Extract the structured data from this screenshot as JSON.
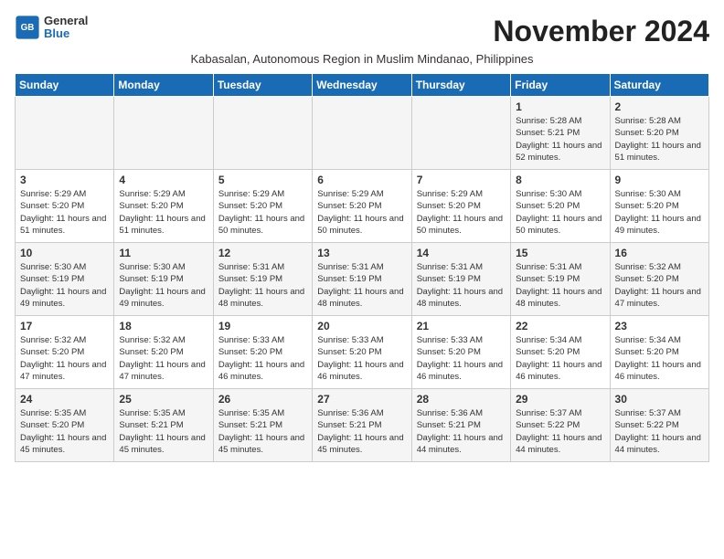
{
  "logo": {
    "general": "General",
    "blue": "Blue"
  },
  "title": "November 2024",
  "subtitle": "Kabasalan, Autonomous Region in Muslim Mindanao, Philippines",
  "headers": [
    "Sunday",
    "Monday",
    "Tuesday",
    "Wednesday",
    "Thursday",
    "Friday",
    "Saturday"
  ],
  "weeks": [
    [
      {
        "day": "",
        "info": ""
      },
      {
        "day": "",
        "info": ""
      },
      {
        "day": "",
        "info": ""
      },
      {
        "day": "",
        "info": ""
      },
      {
        "day": "",
        "info": ""
      },
      {
        "day": "1",
        "info": "Sunrise: 5:28 AM\nSunset: 5:21 PM\nDaylight: 11 hours and 52 minutes."
      },
      {
        "day": "2",
        "info": "Sunrise: 5:28 AM\nSunset: 5:20 PM\nDaylight: 11 hours and 51 minutes."
      }
    ],
    [
      {
        "day": "3",
        "info": "Sunrise: 5:29 AM\nSunset: 5:20 PM\nDaylight: 11 hours and 51 minutes."
      },
      {
        "day": "4",
        "info": "Sunrise: 5:29 AM\nSunset: 5:20 PM\nDaylight: 11 hours and 51 minutes."
      },
      {
        "day": "5",
        "info": "Sunrise: 5:29 AM\nSunset: 5:20 PM\nDaylight: 11 hours and 50 minutes."
      },
      {
        "day": "6",
        "info": "Sunrise: 5:29 AM\nSunset: 5:20 PM\nDaylight: 11 hours and 50 minutes."
      },
      {
        "day": "7",
        "info": "Sunrise: 5:29 AM\nSunset: 5:20 PM\nDaylight: 11 hours and 50 minutes."
      },
      {
        "day": "8",
        "info": "Sunrise: 5:30 AM\nSunset: 5:20 PM\nDaylight: 11 hours and 50 minutes."
      },
      {
        "day": "9",
        "info": "Sunrise: 5:30 AM\nSunset: 5:20 PM\nDaylight: 11 hours and 49 minutes."
      }
    ],
    [
      {
        "day": "10",
        "info": "Sunrise: 5:30 AM\nSunset: 5:19 PM\nDaylight: 11 hours and 49 minutes."
      },
      {
        "day": "11",
        "info": "Sunrise: 5:30 AM\nSunset: 5:19 PM\nDaylight: 11 hours and 49 minutes."
      },
      {
        "day": "12",
        "info": "Sunrise: 5:31 AM\nSunset: 5:19 PM\nDaylight: 11 hours and 48 minutes."
      },
      {
        "day": "13",
        "info": "Sunrise: 5:31 AM\nSunset: 5:19 PM\nDaylight: 11 hours and 48 minutes."
      },
      {
        "day": "14",
        "info": "Sunrise: 5:31 AM\nSunset: 5:19 PM\nDaylight: 11 hours and 48 minutes."
      },
      {
        "day": "15",
        "info": "Sunrise: 5:31 AM\nSunset: 5:19 PM\nDaylight: 11 hours and 48 minutes."
      },
      {
        "day": "16",
        "info": "Sunrise: 5:32 AM\nSunset: 5:20 PM\nDaylight: 11 hours and 47 minutes."
      }
    ],
    [
      {
        "day": "17",
        "info": "Sunrise: 5:32 AM\nSunset: 5:20 PM\nDaylight: 11 hours and 47 minutes."
      },
      {
        "day": "18",
        "info": "Sunrise: 5:32 AM\nSunset: 5:20 PM\nDaylight: 11 hours and 47 minutes."
      },
      {
        "day": "19",
        "info": "Sunrise: 5:33 AM\nSunset: 5:20 PM\nDaylight: 11 hours and 46 minutes."
      },
      {
        "day": "20",
        "info": "Sunrise: 5:33 AM\nSunset: 5:20 PM\nDaylight: 11 hours and 46 minutes."
      },
      {
        "day": "21",
        "info": "Sunrise: 5:33 AM\nSunset: 5:20 PM\nDaylight: 11 hours and 46 minutes."
      },
      {
        "day": "22",
        "info": "Sunrise: 5:34 AM\nSunset: 5:20 PM\nDaylight: 11 hours and 46 minutes."
      },
      {
        "day": "23",
        "info": "Sunrise: 5:34 AM\nSunset: 5:20 PM\nDaylight: 11 hours and 46 minutes."
      }
    ],
    [
      {
        "day": "24",
        "info": "Sunrise: 5:35 AM\nSunset: 5:20 PM\nDaylight: 11 hours and 45 minutes."
      },
      {
        "day": "25",
        "info": "Sunrise: 5:35 AM\nSunset: 5:21 PM\nDaylight: 11 hours and 45 minutes."
      },
      {
        "day": "26",
        "info": "Sunrise: 5:35 AM\nSunset: 5:21 PM\nDaylight: 11 hours and 45 minutes."
      },
      {
        "day": "27",
        "info": "Sunrise: 5:36 AM\nSunset: 5:21 PM\nDaylight: 11 hours and 45 minutes."
      },
      {
        "day": "28",
        "info": "Sunrise: 5:36 AM\nSunset: 5:21 PM\nDaylight: 11 hours and 44 minutes."
      },
      {
        "day": "29",
        "info": "Sunrise: 5:37 AM\nSunset: 5:22 PM\nDaylight: 11 hours and 44 minutes."
      },
      {
        "day": "30",
        "info": "Sunrise: 5:37 AM\nSunset: 5:22 PM\nDaylight: 11 hours and 44 minutes."
      }
    ]
  ]
}
